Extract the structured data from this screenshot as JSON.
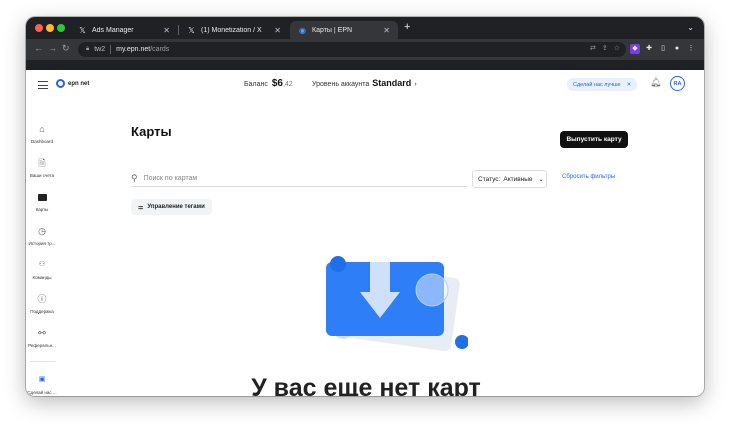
{
  "browser": {
    "tabs": [
      {
        "icon": "x-logo-icon",
        "title": "Ads Manager",
        "active": false
      },
      {
        "icon": "x-logo-icon",
        "title": "(1) Monetization / X",
        "active": false
      },
      {
        "icon": "epn-favicon-icon",
        "title": "Карты | EPN",
        "active": true
      }
    ],
    "address": {
      "prefix": "tw2",
      "host": "my.epn.net",
      "path": "/cards"
    }
  },
  "header": {
    "logo_text": "epn net",
    "balance_label": "Баланс",
    "balance_amount": "$6",
    "balance_cents": ",42",
    "level_label": "Уровень аккаунта",
    "level_value": "Standard",
    "promo_text": "Сделай нас лучше",
    "avatar_initials": "RA"
  },
  "sidebar": {
    "items": [
      {
        "icon": "home-icon",
        "label": "Dashboard"
      },
      {
        "icon": "document-icon",
        "label": "Ваши счета"
      },
      {
        "icon": "card-icon",
        "label": "Карты"
      },
      {
        "icon": "history-icon",
        "label": "История тр..."
      },
      {
        "icon": "team-icon",
        "label": "Команды"
      },
      {
        "icon": "help-icon",
        "label": "Поддержка"
      },
      {
        "icon": "referral-icon",
        "label": "Реферальн..."
      },
      {
        "icon": "feedback-icon",
        "label": "Сделай нас ..."
      }
    ]
  },
  "main": {
    "title": "Карты",
    "issue_button": "Выпустить карту",
    "search_placeholder": "Поиск по картам",
    "status_label": "Статус:",
    "status_value": "Активные",
    "reset_filters": "Сбросить фильтры",
    "tags_button": "Управление тегами",
    "empty_title": "У вас еще нет карт"
  },
  "colors": {
    "accent": "#2563eb",
    "dark": "#111111"
  }
}
